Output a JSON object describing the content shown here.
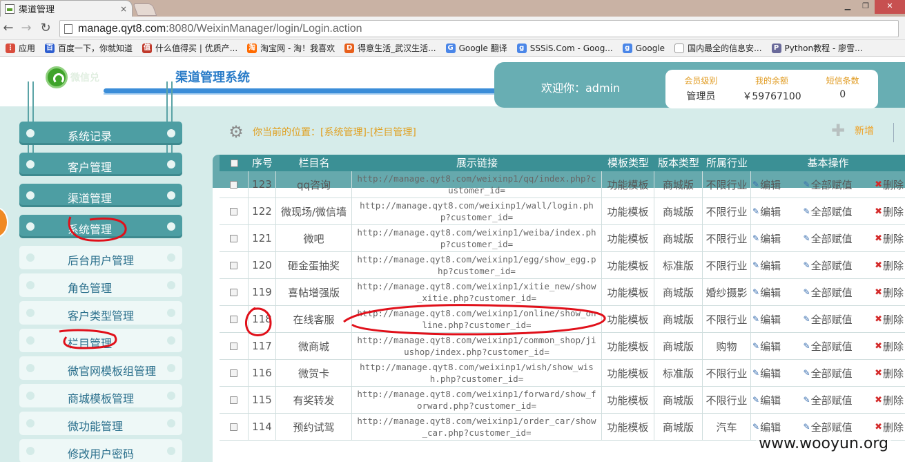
{
  "browser": {
    "tab_title": "渠道管理",
    "tab_close": "×",
    "url_host": "manage.qyt8.com",
    "url_rest": ":8080/WeixinManager/login/Login.action",
    "bookmarks": [
      {
        "label": "应用",
        "color": "#d94c3d",
        "glyph": "⋮"
      },
      {
        "label": "百度一下，你就知道",
        "color": "#2f5fd0",
        "glyph": "百"
      },
      {
        "label": "什么值得买 | 优质产...",
        "color": "#c0392b",
        "glyph": "值"
      },
      {
        "label": "淘宝网 - 淘！我喜欢",
        "color": "#ff6a00",
        "glyph": "淘"
      },
      {
        "label": "得意生活_武汉生活...",
        "color": "#e8601c",
        "glyph": "D"
      },
      {
        "label": "Google 翻译",
        "color": "#4a86e8",
        "glyph": "G"
      },
      {
        "label": "SSSiS.Com - Goog...",
        "color": "#4a86e8",
        "glyph": "g"
      },
      {
        "label": "Google",
        "color": "#4a86e8",
        "glyph": "g"
      },
      {
        "label": "国内最全的信息安...",
        "color": "#ffffff",
        "glyph": ""
      },
      {
        "label": "Python教程 - 廖雪...",
        "color": "#6a6a9a",
        "glyph": "P"
      }
    ]
  },
  "header": {
    "logo_text": "微信兑",
    "system_title": "渠道管理系统",
    "welcome": "欢迎你：admin",
    "info": [
      {
        "label": "会员级别",
        "value": "管理员"
      },
      {
        "label": "我的余额",
        "value": "￥59767100"
      },
      {
        "label": "短信条数",
        "value": "0"
      }
    ]
  },
  "sidebar": {
    "main_items": [
      "系统记录",
      "客户管理",
      "渠道管理",
      "系统管理"
    ],
    "sub_items": [
      "后台用户管理",
      "角色管理",
      "客户类型管理",
      "栏目管理",
      "微官网模板组管理",
      "商城模板管理",
      "微功能管理",
      "修改用户密码"
    ]
  },
  "content": {
    "breadcrumb": "你当前的位置：[系统管理]-[栏目管理]",
    "new_button": "新增",
    "columns": [
      "序号",
      "栏目名",
      "展示链接",
      "模板类型",
      "版本类型",
      "所属行业",
      "基本操作"
    ],
    "rows": [
      {
        "id": "123",
        "name": "qq咨询",
        "link": "http://manage.qyt8.com/weixinp1/qq/index.php?customer_id=",
        "template": "功能模板",
        "version": "商城版",
        "industry": "不限行业"
      },
      {
        "id": "122",
        "name": "微现场/微信墙",
        "link": "http://manage.qyt8.com/weixinp1/wall/login.php?customer_id=",
        "template": "功能模板",
        "version": "商城版",
        "industry": "不限行业"
      },
      {
        "id": "121",
        "name": "微吧",
        "link": "http://manage.qyt8.com/weixinp1/weiba/index.php?customer_id=",
        "template": "功能模板",
        "version": "商城版",
        "industry": "不限行业"
      },
      {
        "id": "120",
        "name": "砸金蛋抽奖",
        "link": "http://manage.qyt8.com/weixinp1/egg/show_egg.php?customer_id=",
        "template": "功能模板",
        "version": "标准版",
        "industry": "不限行业"
      },
      {
        "id": "119",
        "name": "喜帖增强版",
        "link": "http://manage.qyt8.com/weixinp1/xitie_new/show_xitie.php?customer_id=",
        "template": "功能模板",
        "version": "商城版",
        "industry": "婚纱摄影"
      },
      {
        "id": "118",
        "name": "在线客服",
        "link": "http://manage.qyt8.com/weixinp1/online/show_online.php?customer_id=",
        "template": "功能模板",
        "version": "商城版",
        "industry": "不限行业"
      },
      {
        "id": "117",
        "name": "微商城",
        "link": "http://manage.qyt8.com/weixinp1/common_shop/jiushop/index.php?customer_id=",
        "template": "功能模板",
        "version": "商城版",
        "industry": "购物"
      },
      {
        "id": "116",
        "name": "微贺卡",
        "link": "http://manage.qyt8.com/weixinp1/wish/show_wish.php?customer_id=",
        "template": "功能模板",
        "version": "标准版",
        "industry": "不限行业"
      },
      {
        "id": "115",
        "name": "有奖转发",
        "link": "http://manage.qyt8.com/weixinp1/forward/show_forward.php?customer_id=",
        "template": "功能模板",
        "version": "商城版",
        "industry": "不限行业"
      },
      {
        "id": "114",
        "name": "预约试驾",
        "link": "http://manage.qyt8.com/weixinp1/order_car/show_car.php?customer_id=",
        "template": "功能模板",
        "version": "商城版",
        "industry": "汽车"
      }
    ],
    "ops": {
      "edit": "编辑",
      "assign_all": "全部赋值",
      "delete": "删除"
    }
  },
  "watermark": "www.wooyun.org",
  "colors": {
    "accent": "#3b9095",
    "annotation_red": "#e0101a"
  }
}
